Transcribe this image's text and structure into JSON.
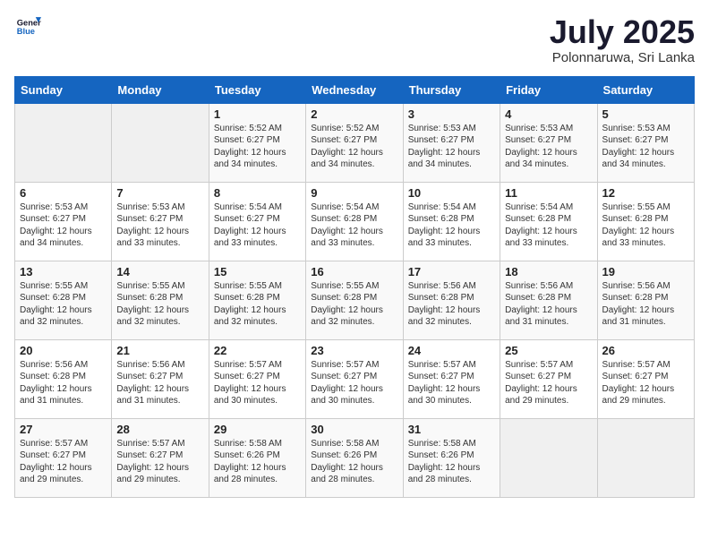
{
  "header": {
    "logo_general": "General",
    "logo_blue": "Blue",
    "month": "July 2025",
    "location": "Polonnaruwa, Sri Lanka"
  },
  "weekdays": [
    "Sunday",
    "Monday",
    "Tuesday",
    "Wednesday",
    "Thursday",
    "Friday",
    "Saturday"
  ],
  "weeks": [
    [
      {
        "day": "",
        "detail": ""
      },
      {
        "day": "",
        "detail": ""
      },
      {
        "day": "1",
        "detail": "Sunrise: 5:52 AM\nSunset: 6:27 PM\nDaylight: 12 hours\nand 34 minutes."
      },
      {
        "day": "2",
        "detail": "Sunrise: 5:52 AM\nSunset: 6:27 PM\nDaylight: 12 hours\nand 34 minutes."
      },
      {
        "day": "3",
        "detail": "Sunrise: 5:53 AM\nSunset: 6:27 PM\nDaylight: 12 hours\nand 34 minutes."
      },
      {
        "day": "4",
        "detail": "Sunrise: 5:53 AM\nSunset: 6:27 PM\nDaylight: 12 hours\nand 34 minutes."
      },
      {
        "day": "5",
        "detail": "Sunrise: 5:53 AM\nSunset: 6:27 PM\nDaylight: 12 hours\nand 34 minutes."
      }
    ],
    [
      {
        "day": "6",
        "detail": "Sunrise: 5:53 AM\nSunset: 6:27 PM\nDaylight: 12 hours\nand 34 minutes."
      },
      {
        "day": "7",
        "detail": "Sunrise: 5:53 AM\nSunset: 6:27 PM\nDaylight: 12 hours\nand 33 minutes."
      },
      {
        "day": "8",
        "detail": "Sunrise: 5:54 AM\nSunset: 6:27 PM\nDaylight: 12 hours\nand 33 minutes."
      },
      {
        "day": "9",
        "detail": "Sunrise: 5:54 AM\nSunset: 6:28 PM\nDaylight: 12 hours\nand 33 minutes."
      },
      {
        "day": "10",
        "detail": "Sunrise: 5:54 AM\nSunset: 6:28 PM\nDaylight: 12 hours\nand 33 minutes."
      },
      {
        "day": "11",
        "detail": "Sunrise: 5:54 AM\nSunset: 6:28 PM\nDaylight: 12 hours\nand 33 minutes."
      },
      {
        "day": "12",
        "detail": "Sunrise: 5:55 AM\nSunset: 6:28 PM\nDaylight: 12 hours\nand 33 minutes."
      }
    ],
    [
      {
        "day": "13",
        "detail": "Sunrise: 5:55 AM\nSunset: 6:28 PM\nDaylight: 12 hours\nand 32 minutes."
      },
      {
        "day": "14",
        "detail": "Sunrise: 5:55 AM\nSunset: 6:28 PM\nDaylight: 12 hours\nand 32 minutes."
      },
      {
        "day": "15",
        "detail": "Sunrise: 5:55 AM\nSunset: 6:28 PM\nDaylight: 12 hours\nand 32 minutes."
      },
      {
        "day": "16",
        "detail": "Sunrise: 5:55 AM\nSunset: 6:28 PM\nDaylight: 12 hours\nand 32 minutes."
      },
      {
        "day": "17",
        "detail": "Sunrise: 5:56 AM\nSunset: 6:28 PM\nDaylight: 12 hours\nand 32 minutes."
      },
      {
        "day": "18",
        "detail": "Sunrise: 5:56 AM\nSunset: 6:28 PM\nDaylight: 12 hours\nand 31 minutes."
      },
      {
        "day": "19",
        "detail": "Sunrise: 5:56 AM\nSunset: 6:28 PM\nDaylight: 12 hours\nand 31 minutes."
      }
    ],
    [
      {
        "day": "20",
        "detail": "Sunrise: 5:56 AM\nSunset: 6:28 PM\nDaylight: 12 hours\nand 31 minutes."
      },
      {
        "day": "21",
        "detail": "Sunrise: 5:56 AM\nSunset: 6:27 PM\nDaylight: 12 hours\nand 31 minutes."
      },
      {
        "day": "22",
        "detail": "Sunrise: 5:57 AM\nSunset: 6:27 PM\nDaylight: 12 hours\nand 30 minutes."
      },
      {
        "day": "23",
        "detail": "Sunrise: 5:57 AM\nSunset: 6:27 PM\nDaylight: 12 hours\nand 30 minutes."
      },
      {
        "day": "24",
        "detail": "Sunrise: 5:57 AM\nSunset: 6:27 PM\nDaylight: 12 hours\nand 30 minutes."
      },
      {
        "day": "25",
        "detail": "Sunrise: 5:57 AM\nSunset: 6:27 PM\nDaylight: 12 hours\nand 29 minutes."
      },
      {
        "day": "26",
        "detail": "Sunrise: 5:57 AM\nSunset: 6:27 PM\nDaylight: 12 hours\nand 29 minutes."
      }
    ],
    [
      {
        "day": "27",
        "detail": "Sunrise: 5:57 AM\nSunset: 6:27 PM\nDaylight: 12 hours\nand 29 minutes."
      },
      {
        "day": "28",
        "detail": "Sunrise: 5:57 AM\nSunset: 6:27 PM\nDaylight: 12 hours\nand 29 minutes."
      },
      {
        "day": "29",
        "detail": "Sunrise: 5:58 AM\nSunset: 6:26 PM\nDaylight: 12 hours\nand 28 minutes."
      },
      {
        "day": "30",
        "detail": "Sunrise: 5:58 AM\nSunset: 6:26 PM\nDaylight: 12 hours\nand 28 minutes."
      },
      {
        "day": "31",
        "detail": "Sunrise: 5:58 AM\nSunset: 6:26 PM\nDaylight: 12 hours\nand 28 minutes."
      },
      {
        "day": "",
        "detail": ""
      },
      {
        "day": "",
        "detail": ""
      }
    ]
  ]
}
